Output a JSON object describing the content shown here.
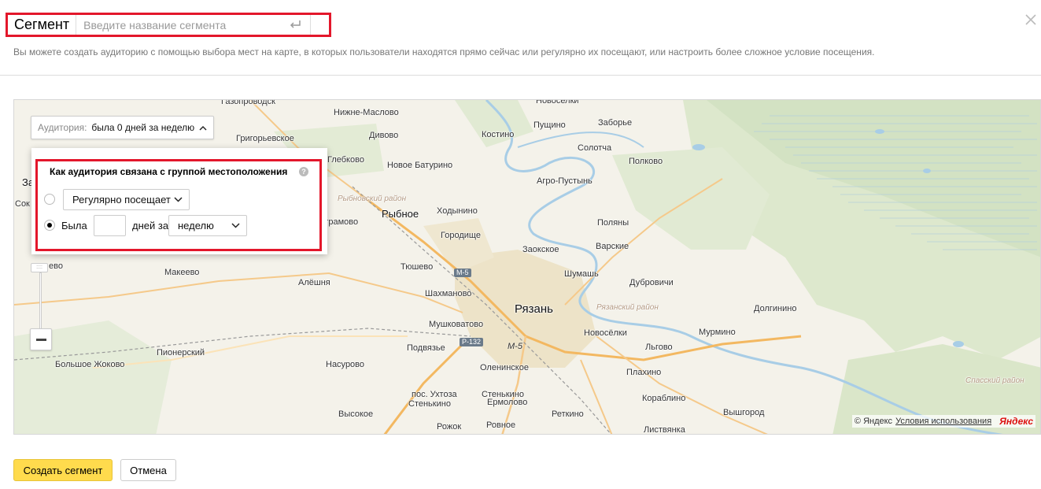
{
  "header": {
    "title": "Сегмент",
    "name_placeholder": "Введите название сегмента",
    "description": "Вы можете создать аудиторию с помощью выбора мест на карте, в которых пользователи находятся прямо сейчас или регулярно их посещают, или настроить более сложное условие посещения."
  },
  "audience": {
    "label": "Аудитория:",
    "value": "была 0 дней за неделю"
  },
  "popup": {
    "title": "Как аудитория связана с группой местоположения",
    "help": "?",
    "option_regular": "Регулярно посещает",
    "option_was": "Была",
    "days_value": "",
    "days_for_label": "дней за",
    "period": "неделю"
  },
  "zoom": {
    "handle": "::::"
  },
  "map": {
    "labels": {
      "gazoprovodsk": "Газопроводск",
      "nizhne_maslovo": "Нижне-Маслово",
      "novoselki_top": "Новоселки",
      "zaborye": "Заборье",
      "pushchino": "Пущино",
      "grigorievskoe": "Григорьевское",
      "divovo": "Дивово",
      "kostino": "Костино",
      "solotcha": "Солотча",
      "glebkovo": "Глебково",
      "novoe_baturino": "Новое Батурино",
      "polkovo": "Полково",
      "agro_pustyn": "Агро-Пустынь",
      "za": "За",
      "sok": "Сок",
      "rybnovsky": "Рыбновский район",
      "rybnoe": "Рыбное",
      "khodynino": "Ходынино",
      "bagramovo": "Баграмово",
      "gorodishche": "Городище",
      "polyany": "Поляны",
      "zaokskoe": "Заокское",
      "varskie": "Варские",
      "evo": "ево",
      "tyushevo": "Тюшево",
      "shumash": "Шумашь",
      "makeevo": "Макеево",
      "alyoshnya": "Алёшня",
      "dubrovichi": "Дубровичи",
      "shakhmanovo": "Шахманово",
      "ryazan": "Рязань",
      "ryazansky": "Рязанский район",
      "dolginino": "Долгинино",
      "mushkovatovo": "Мушковатово",
      "novoselki": "Новосёлки",
      "murmino": "Мурмино",
      "podvyazye": "Подвязье",
      "lgovo": "Льгово",
      "pionersky": "Пионерский",
      "bolshoe_zhokovo": "Большое Жоково",
      "olenitsinskoe": "Оленинское",
      "plakhino": "Плахино",
      "nasurovo": "Насурово",
      "ukhtoza": "пос. Ухтоза",
      "stenkino1": "Стенькино",
      "stenkino2": "Стенькино",
      "korablino": "Кораблино",
      "spassky": "Спасский район",
      "vysokoe": "Высокое",
      "retkino": "Реткино",
      "vyshgorod": "Вышгород",
      "rozhok": "Рожок",
      "rovnoe": "Ровное",
      "listvyanka": "Листвянка",
      "ermolovo": "Ермолово",
      "m5": "М-5",
      "r132": "Р-132",
      "m5b": "М-5"
    },
    "copyright": "© Яндекс",
    "terms": "Условия использования",
    "logo": "Яндекс"
  },
  "footer": {
    "create": "Создать сегмент",
    "cancel": "Отмена"
  },
  "colors": {
    "accent_red": "#e3172b",
    "create_bg": "#ffdb4d"
  }
}
